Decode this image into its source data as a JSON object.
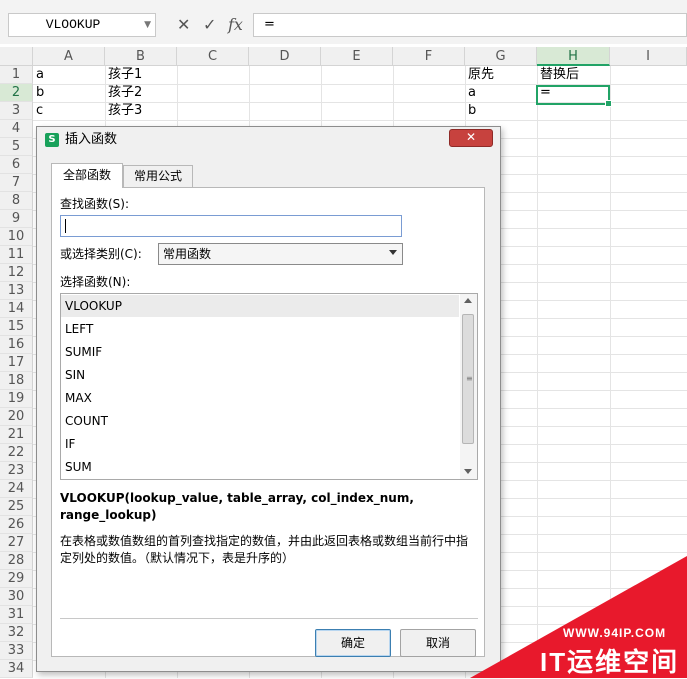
{
  "formula_bar": {
    "name_box": "VLOOKUP",
    "cancel_icon": "✕",
    "enter_icon": "✓",
    "fx_label": "fx",
    "formula": "="
  },
  "columns": [
    "A",
    "B",
    "C",
    "D",
    "E",
    "F",
    "G",
    "H",
    "I"
  ],
  "active_column": "H",
  "rows": [
    "1",
    "2",
    "3",
    "4",
    "5",
    "6",
    "7",
    "8",
    "9",
    "10",
    "11",
    "12",
    "13",
    "14",
    "15",
    "16",
    "17",
    "18",
    "19",
    "20",
    "21",
    "22",
    "23",
    "24",
    "25",
    "26",
    "27",
    "28",
    "29",
    "30",
    "31",
    "32",
    "33",
    "34"
  ],
  "active_row": "2",
  "cells": {
    "A1": "a",
    "B1": "孩子1",
    "G1": "原先",
    "H1": "替换后",
    "A2": "b",
    "B2": "孩子2",
    "G2": "a",
    "H2": "=",
    "A3": "c",
    "B3": "孩子3",
    "G3": "b"
  },
  "dialog": {
    "title": "插入函数",
    "app_icon": "S",
    "close_icon": "✕",
    "tabs": [
      {
        "label": "全部函数",
        "active": true
      },
      {
        "label": "常用公式",
        "active": false
      }
    ],
    "search_label": "查找函数(S):",
    "search_value": "",
    "category_label": "或选择类别(C):",
    "category_value": "常用函数",
    "functions_label": "选择函数(N):",
    "functions": [
      "VLOOKUP",
      "LEFT",
      "SUMIF",
      "SIN",
      "MAX",
      "COUNT",
      "IF",
      "SUM"
    ],
    "selected_function": "VLOOKUP",
    "signature": "VLOOKUP(lookup_value, table_array, col_index_num, range_lookup)",
    "description": "在表格或数值数组的首列查找指定的数值，并由此返回表格或数组当前行中指定列处的数值。（默认情况下，表是升序的）",
    "ok_label": "确定",
    "cancel_label": "取消"
  },
  "watermark": {
    "url": "WWW.94IP.COM",
    "brand": "IT运维空间",
    "color": "#e8192c"
  },
  "colors": {
    "accent": "#21a366",
    "close_button": "#c7423e"
  }
}
